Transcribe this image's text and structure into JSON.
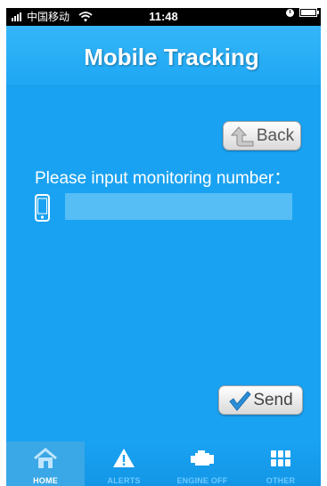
{
  "status_bar": {
    "carrier": "中国移动",
    "time": "11:48"
  },
  "header": {
    "title": "Mobile Tracking"
  },
  "back_button": {
    "label": "Back",
    "icon": "back-arrow-icon"
  },
  "form": {
    "prompt": "Please input monitoring number：",
    "number_value": "",
    "number_placeholder": ""
  },
  "send_button": {
    "label": "Send",
    "icon": "checkmark-icon"
  },
  "tabs": [
    {
      "label": "HOME",
      "icon": "home-icon",
      "active": true
    },
    {
      "label": "ALERTS",
      "icon": "warning-icon",
      "active": false
    },
    {
      "label": "ENGINE OFF",
      "icon": "engine-icon",
      "active": false
    },
    {
      "label": "OTHER",
      "icon": "grid-icon",
      "active": false
    }
  ],
  "colors": {
    "background": "#1aa2f2",
    "input": "#56bef5",
    "accent": "#2a8fd8"
  }
}
